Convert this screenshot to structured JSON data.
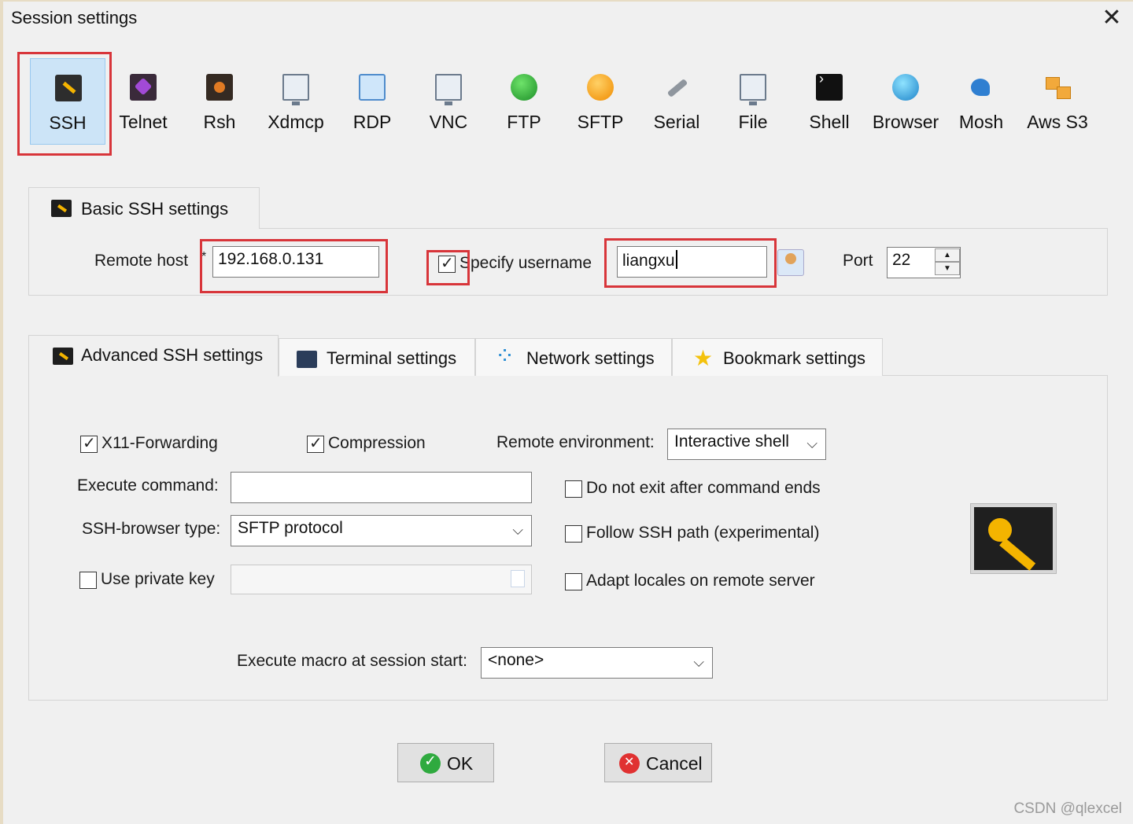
{
  "window": {
    "title": "Session settings"
  },
  "session_types": [
    {
      "label": "SSH",
      "icon": "ssh-key-icon",
      "selected": true
    },
    {
      "label": "Telnet",
      "icon": "telnet-icon"
    },
    {
      "label": "Rsh",
      "icon": "rsh-icon"
    },
    {
      "label": "Xdmcp",
      "icon": "xdmcp-monitor-icon"
    },
    {
      "label": "RDP",
      "icon": "rdp-monitor-icon"
    },
    {
      "label": "VNC",
      "icon": "vnc-monitor-icon"
    },
    {
      "label": "FTP",
      "icon": "ftp-globe-icon"
    },
    {
      "label": "SFTP",
      "icon": "sftp-globe-icon"
    },
    {
      "label": "Serial",
      "icon": "serial-plug-icon"
    },
    {
      "label": "File",
      "icon": "file-monitor-icon"
    },
    {
      "label": "Shell",
      "icon": "shell-terminal-icon"
    },
    {
      "label": "Browser",
      "icon": "browser-globe-icon"
    },
    {
      "label": "Mosh",
      "icon": "mosh-satellite-icon"
    },
    {
      "label": "Aws S3",
      "icon": "aws-boxes-icon"
    }
  ],
  "basic": {
    "tab_label": "Basic SSH settings",
    "remote_host_label": "Remote host",
    "required_mark": "*",
    "remote_host_value": "192.168.0.131",
    "specify_username_label": "Specify username",
    "specify_username_checked": true,
    "username_value": "liangxu",
    "port_label": "Port",
    "port_value": "22"
  },
  "advanced_tabs": [
    {
      "label": "Advanced SSH settings",
      "active": true
    },
    {
      "label": "Terminal settings"
    },
    {
      "label": "Network settings"
    },
    {
      "label": "Bookmark settings"
    }
  ],
  "advanced": {
    "x11_label": "X11-Forwarding",
    "x11_checked": true,
    "compression_label": "Compression",
    "compression_checked": true,
    "remote_env_label": "Remote environment:",
    "remote_env_value": "Interactive shell",
    "execute_command_label": "Execute command:",
    "execute_command_value": "",
    "do_not_exit_label": "Do not exit after command ends",
    "ssh_browser_label": "SSH-browser type:",
    "ssh_browser_value": "SFTP protocol",
    "follow_ssh_path_label": "Follow SSH path (experimental)",
    "use_private_key_label": "Use private key",
    "private_key_value": "",
    "adapt_locales_label": "Adapt locales on remote server",
    "macro_label": "Execute macro at session start:",
    "macro_value": "<none>"
  },
  "buttons": {
    "ok": "OK",
    "cancel": "Cancel"
  },
  "watermark": "CSDN @qlexcel",
  "colors": {
    "highlight": "#d8353a",
    "selected_bg": "#cce4f7",
    "key_yellow": "#f4b400"
  }
}
